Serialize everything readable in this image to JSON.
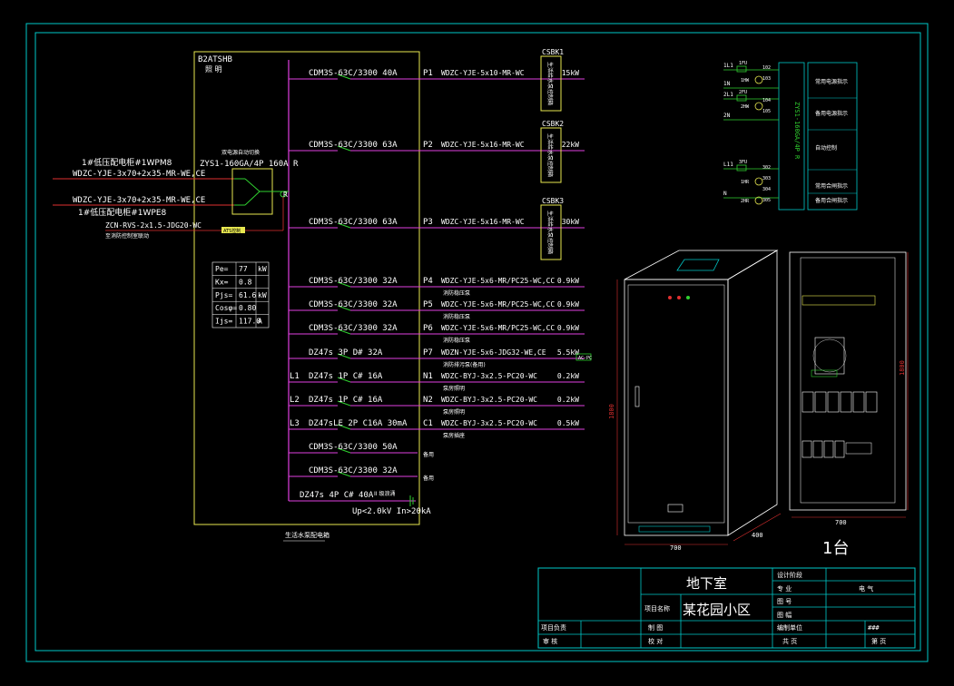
{
  "colors": {
    "background": "#000000",
    "frame": "#00c8c8",
    "panel": "#e8e850",
    "bus": "#e040e0",
    "feed": "#e03030",
    "switch": "#30d030",
    "text": "#ffffff",
    "tag": "#e8e850"
  },
  "panel": {
    "id": "B2ATSHB",
    "sub": "照 明",
    "bottom_label": "生活水泵配电箱"
  },
  "incoming": {
    "feed1_title": "1#低压配电柜#1WPM8",
    "feed1_cable": "WDZC-YJE-3x70+2x35-MR-WE,CE",
    "feed2_cable": "WDZC-YJE-3x70+2x35-MR-WE,CE",
    "feed2_title": "1#低压配电柜#1WPE8",
    "control_cable": "ZCN-RVS-2x1.5-JDG20-WC",
    "control_note": "至消防控制室联动",
    "ats_note": "双电源自动切换",
    "ats_model": "ZYS1-160GA/4P 160A R",
    "r_mark": "R",
    "ats_tag": "ATS控制"
  },
  "load_table": [
    {
      "key": "Pe=",
      "value": "77",
      "unit": "kW"
    },
    {
      "key": "Kx=",
      "value": "0.8",
      "unit": ""
    },
    {
      "key": "Pjs=",
      "value": "61.6",
      "unit": "kW"
    },
    {
      "key": "Cosφ=",
      "value": "0.80",
      "unit": ""
    },
    {
      "key": "Ijs=",
      "value": "117.0",
      "unit": "A"
    }
  ],
  "circuits": [
    {
      "phase": "",
      "breaker": "CDM3S-63C/3300 40A",
      "id": "P1",
      "cable": "WDZC-YJE-5x10-MR-WC",
      "power": "15kW",
      "note": ""
    },
    {
      "phase": "",
      "breaker": "CDM3S-63C/3300 63A",
      "id": "P2",
      "cable": "WDZC-YJE-5x16-MR-WC",
      "power": "22kW",
      "note": ""
    },
    {
      "phase": "",
      "breaker": "CDM3S-63C/3300 63A",
      "id": "P3",
      "cable": "WDZC-YJE-5x16-MR-WC",
      "power": "30kW",
      "note": ""
    },
    {
      "phase": "",
      "breaker": "CDM3S-63C/3300 32A",
      "id": "P4",
      "cable": "WDZC-YJE-5x6-MR/PC25-WC,CC",
      "power": "0.9kW",
      "note": "消防稳压泵"
    },
    {
      "phase": "",
      "breaker": "CDM3S-63C/3300 32A",
      "id": "P5",
      "cable": "WDZC-YJE-5x6-MR/PC25-WC,CC",
      "power": "0.9kW",
      "note": "消防稳压泵"
    },
    {
      "phase": "",
      "breaker": "CDM3S-63C/3300 32A",
      "id": "P6",
      "cable": "WDZC-YJE-5x6-MR/PC25-WC,CC",
      "power": "0.9kW",
      "note": "消防稳压泵"
    },
    {
      "phase": "",
      "breaker": "DZ47s 3P D# 32A",
      "id": "P7",
      "cable": "WDZN-YJE-5x6-JDG32-WE,CE",
      "power": "5.5kW",
      "note": "消防排污泵(备用)"
    },
    {
      "phase": "L1",
      "breaker": "DZ47s 1P C# 16A",
      "id": "N1",
      "cable": "WDZC-BYJ-3x2.5-PC20-WC",
      "power": "0.2kW",
      "note": "泵房照明"
    },
    {
      "phase": "L2",
      "breaker": "DZ47s 1P C# 16A",
      "id": "N2",
      "cable": "WDZC-BYJ-3x2.5-PC20-WC",
      "power": "0.2kW",
      "note": "泵房照明"
    },
    {
      "phase": "L3",
      "breaker": "DZ47sLE 2P C16A 30mA",
      "id": "C1",
      "cable": "WDZC-BYJ-3x2.5-PC20-WC",
      "power": "0.5kW",
      "note": "泵房插座"
    },
    {
      "phase": "",
      "breaker": "CDM3S-63C/3300 50A",
      "id": "",
      "cable": "",
      "power": "",
      "note": "备用"
    },
    {
      "phase": "",
      "breaker": "CDM3S-63C/3300 32A",
      "id": "",
      "cable": "",
      "power": "",
      "note": "备用"
    }
  ],
  "spd": {
    "breaker": "DZ47s 4P C# 40A",
    "tag": "II 级浪涌",
    "rating": "Up<2.0kV In>20kA"
  },
  "equipment": [
    {
      "id": "CSBK1",
      "label": "生活给水泵控制箱"
    },
    {
      "id": "CSBK2",
      "label": "生活给水泵控制箱"
    },
    {
      "id": "CSBK3",
      "label": "生活给水泵控制箱"
    }
  ],
  "p7_tag": "AC-PC",
  "control": {
    "model": "ZYS1-160GA/4P R",
    "left_labels": [
      "1L1",
      "1N",
      "2L1",
      "2N",
      "L11",
      "N"
    ],
    "fuse_labels": [
      "1FU",
      "2FU",
      "3FU"
    ],
    "lamp_labels": [
      "1HW",
      "2HW",
      "1HR",
      "2HR"
    ],
    "terminals": [
      "102",
      "103",
      "104",
      "105",
      "302",
      "303",
      "304",
      "305"
    ],
    "right_labels": [
      "常用电源指示",
      "备用电源指示",
      "自动控制",
      "常用合闸指示",
      "备用合闸指示"
    ]
  },
  "cabinet": {
    "height_dim": "1800",
    "width_dim": "700",
    "depth_dim": "400",
    "count": "1台"
  },
  "elevation": {
    "height_dim": "1800",
    "width_dim": "700"
  },
  "title_block": {
    "project_sub": "地下室",
    "project_label": "项目名称",
    "project_name": "某花园小区",
    "design_stage_label": "设计阶段",
    "specialty_label": "专 业",
    "specialty_value": "电 气",
    "drawing_no_label": "图 号",
    "scale_label": "图 幅",
    "date_label": "日 期",
    "person_label": "项目负责",
    "draw_label": "制 图",
    "unit_label": "编制单位",
    "unit_value": "###",
    "review_label": "审 核",
    "check_label": "校 对",
    "total_label": "共 页",
    "page_label": "第 页"
  }
}
